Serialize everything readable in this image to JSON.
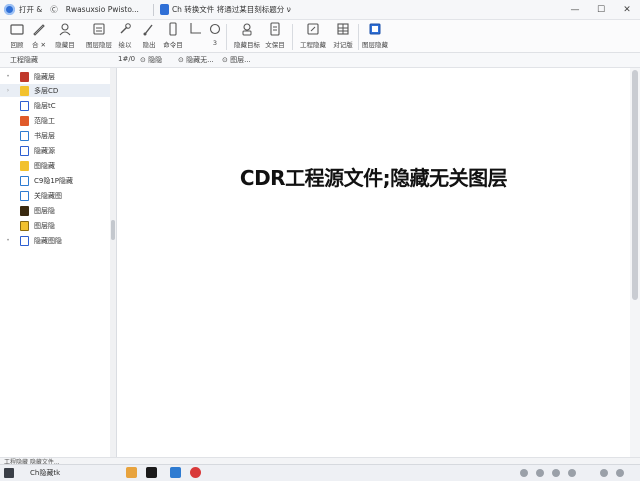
{
  "titlebar": {
    "menu_items": [
      "打开 &",
      "Ⓒ",
      "Rwasuxsio Pwisto..."
    ],
    "doc_title": "Ch 转换文件 将通过某目刻标题分 ν"
  },
  "window_controls": {
    "minimize": "—",
    "maximize": "☐",
    "close": "✕"
  },
  "ribbon": {
    "buttons": [
      {
        "label": "回顾"
      },
      {
        "label": "合 ✕"
      },
      {
        "label": "隐藏目"
      },
      {
        "label": "图层隐层"
      },
      {
        "label": "绘以"
      },
      {
        "label": "隐出"
      },
      {
        "label": "命令目"
      },
      {
        "label": ""
      },
      {
        "label": "3"
      },
      {
        "label": "隐藏目标"
      },
      {
        "label": "文保目"
      },
      {
        "label": "工程隐藏"
      },
      {
        "label": "对记版"
      },
      {
        "label": "图层隐藏"
      }
    ]
  },
  "tabstrip": {
    "tabs": [
      "1#/0",
      "⊙ 隐隐",
      "⊙ 隐藏无...",
      "⊙ 图层..."
    ]
  },
  "sidebar": {
    "header": "工程隐藏",
    "items": [
      {
        "label": "隐藏层",
        "color": "#c0392b",
        "has_arrow": true
      },
      {
        "label": "多层CD",
        "color": "#f2c12e",
        "has_arrow": true,
        "selected": true
      },
      {
        "label": "隐层tC",
        "color": "#2e5fd1",
        "has_arrow": false
      },
      {
        "label": "范隐工",
        "color": "#e05a2a",
        "has_arrow": false
      },
      {
        "label": "书层层",
        "color": "#2e7bd1",
        "has_arrow": false
      },
      {
        "label": "隐藏源",
        "color": "#2e5fd1",
        "has_arrow": false
      },
      {
        "label": "图隐藏",
        "color": "#f2c12e",
        "has_arrow": false
      },
      {
        "label": "C9隐1P隐藏",
        "color": "#2e7bd1",
        "has_arrow": false
      },
      {
        "label": "关隐藏图",
        "color": "#2e7bd1",
        "has_arrow": false
      },
      {
        "label": "图层隐",
        "color": "#3a2a10",
        "has_arrow": false
      },
      {
        "label": "图层隐",
        "color": "#f2c12e",
        "has_arrow": false
      },
      {
        "label": "隐藏图隐",
        "color": "#2e5fd1",
        "has_arrow": true
      }
    ]
  },
  "canvas": {
    "overlay_title": "CDR工程源文件;隐藏无关图层"
  },
  "statusbar": {
    "text": "工程隐藏 隐藏文件..."
  },
  "taskbar": {
    "label": "Ch隐藏tk",
    "apps": [
      {
        "icon": "file-explorer-icon",
        "color": "#e8a33d"
      },
      {
        "icon": "coreldraw-icon",
        "color": "#1a1a1a"
      },
      {
        "icon": "browser-icon",
        "color": "#2e7bd1"
      },
      {
        "icon": "opera-icon",
        "color": "#d93a3a"
      }
    ]
  }
}
